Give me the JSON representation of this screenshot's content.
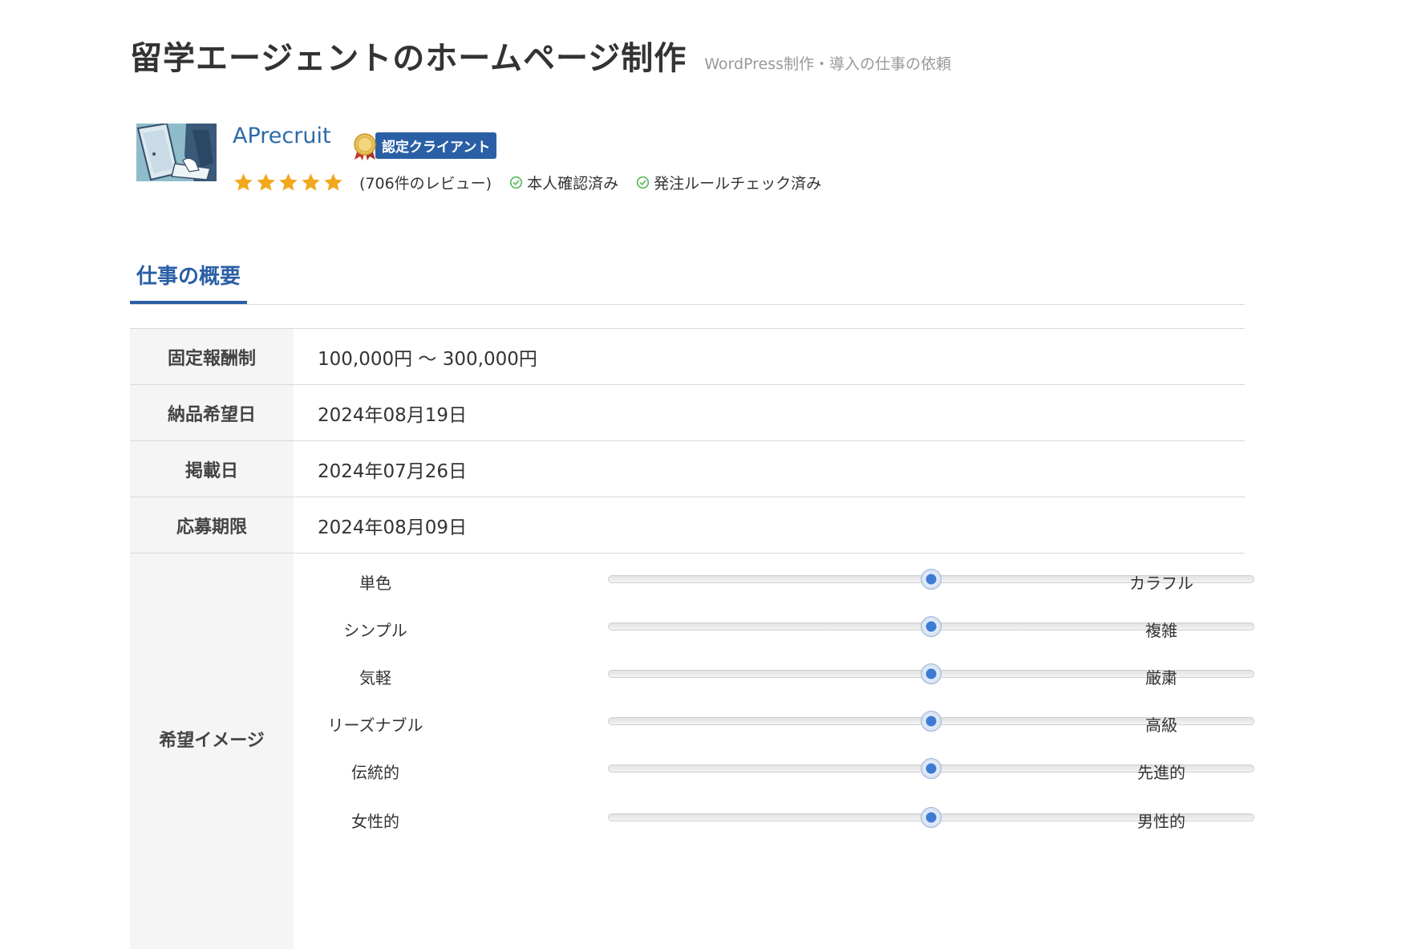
{
  "header": {
    "title": "留学エージェントのホームページ制作",
    "category": "WordPress制作・導入の仕事の依頼"
  },
  "client": {
    "name": "APrecruit",
    "badge": "認定クライアント",
    "rating": 5,
    "reviews": "(706件のレビュー)",
    "verifications": [
      "本人確認済み",
      "発注ルールチェック済み"
    ]
  },
  "section": {
    "tab": "仕事の概要"
  },
  "details": [
    {
      "label": "固定報酬制",
      "value": "100,000円 〜 300,000円"
    },
    {
      "label": "納品希望日",
      "value": "2024年08月19日"
    },
    {
      "label": "掲載日",
      "value": "2024年07月26日"
    },
    {
      "label": "応募期限",
      "value": "2024年08月09日"
    }
  ],
  "image_preferences": {
    "label": "希望イメージ",
    "scales": [
      {
        "left": "単色",
        "right": "カラフル",
        "level": 0.5
      },
      {
        "left": "シンプル",
        "right": "複雑",
        "level": 0.5
      },
      {
        "left": "気軽",
        "right": "厳粛",
        "level": 0.5
      },
      {
        "left": "リーズナブル",
        "right": "高級",
        "level": 0.5
      },
      {
        "left": "伝統的",
        "right": "先進的",
        "level": 0.5
      },
      {
        "left": "女性的",
        "right": "男性的",
        "level": 0.5
      }
    ]
  },
  "colors": {
    "accent": "#2a5fa6",
    "link": "#2b6aa8",
    "star": "#f2a81d",
    "check": "#5cb85c",
    "label_bg": "#f5f5f5"
  }
}
